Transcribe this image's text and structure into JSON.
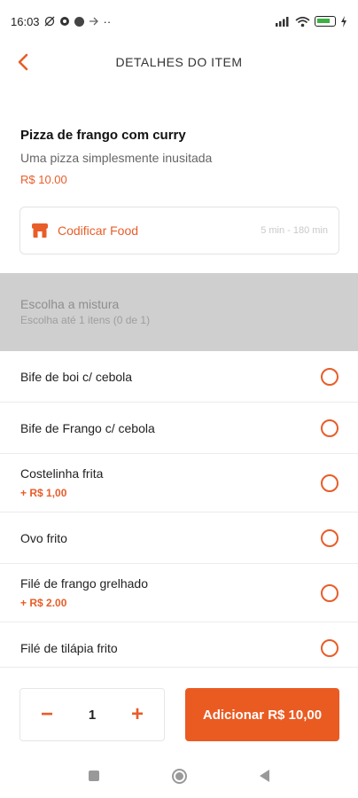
{
  "status_bar": {
    "time": "16:03",
    "extra": "··"
  },
  "header": {
    "title": "DETALHES DO ITEM"
  },
  "item": {
    "name": "Pizza de frango com curry",
    "description": "Uma pizza simplesmente inusitada",
    "price": "R$ 10.00"
  },
  "store": {
    "name": "Codificar Food",
    "time": "5 min - 180 min"
  },
  "choice": {
    "title": "Escolha a mistura",
    "subtitle": "Escolha até 1 itens (0 de 1)"
  },
  "options": [
    {
      "label": "Bife de boi c/ cebola",
      "price": ""
    },
    {
      "label": "Bife de Frango c/ cebola",
      "price": ""
    },
    {
      "label": "Costelinha frita",
      "price": "+ R$ 1,00"
    },
    {
      "label": "Ovo frito",
      "price": ""
    },
    {
      "label": "Filé de frango grelhado",
      "price": "+ R$ 2.00"
    },
    {
      "label": "Filé de tilápia frito",
      "price": ""
    }
  ],
  "cart": {
    "minus": "−",
    "quantity": "1",
    "plus": "+",
    "add_label": "Adicionar R$ 10,00"
  },
  "colors": {
    "accent": "#e85d29",
    "button": "#ea5b22",
    "section_bg": "#cfcfcf"
  },
  "icons": {
    "back": "chevron-left-icon",
    "store": "store-icon",
    "radio": "radio-unselected-icon",
    "nav_recent": "square-icon",
    "nav_home": "circle-icon",
    "nav_back": "triangle-back-icon"
  }
}
